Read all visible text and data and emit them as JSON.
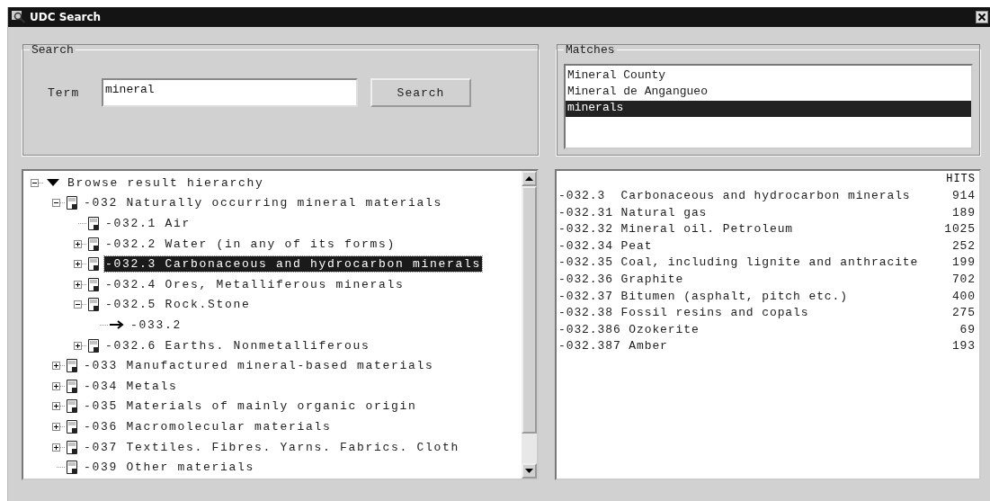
{
  "window": {
    "title": "UDC Search"
  },
  "search": {
    "legend": "Search",
    "term_label": "Term",
    "term_value": "mineral",
    "button": "Search"
  },
  "matches": {
    "legend": "Matches",
    "items": [
      {
        "label": "Mineral County",
        "selected": false
      },
      {
        "label": "Mineral de Angangueo",
        "selected": false
      },
      {
        "label": "minerals",
        "selected": true
      }
    ]
  },
  "tree": {
    "root": {
      "label": "Browse result hierarchy",
      "kind": "root",
      "expanded": true,
      "selected": false,
      "children": [
        {
          "label": "-032 Naturally occurring mineral materials",
          "kind": "doc",
          "expanded": true,
          "selected": false,
          "children": [
            {
              "label": "-032.1 Air",
              "kind": "doc",
              "selected": false
            },
            {
              "label": "-032.2 Water (in any of its forms)",
              "kind": "doc",
              "expanded": false,
              "selected": false
            },
            {
              "label": "-032.3 Carbonaceous and hydrocarbon minerals",
              "kind": "doc",
              "expanded": false,
              "selected": true
            },
            {
              "label": "-032.4 Ores, Metalliferous minerals",
              "kind": "doc",
              "expanded": false,
              "selected": false
            },
            {
              "label": "-032.5 Rock.Stone",
              "kind": "doc",
              "expanded": true,
              "selected": false,
              "children": [
                {
                  "label": "-033.2",
                  "kind": "ref",
                  "selected": false
                }
              ]
            },
            {
              "label": "-032.6 Earths. Nonmetalliferous",
              "kind": "doc",
              "expanded": false,
              "selected": false
            }
          ]
        },
        {
          "label": "-033 Manufactured mineral-based materials",
          "kind": "doc",
          "expanded": false,
          "selected": false
        },
        {
          "label": "-034 Metals",
          "kind": "doc",
          "expanded": false,
          "selected": false
        },
        {
          "label": "-035 Materials of mainly organic origin",
          "kind": "doc",
          "expanded": false,
          "selected": false
        },
        {
          "label": "-036 Macromolecular materials",
          "kind": "doc",
          "expanded": false,
          "selected": false
        },
        {
          "label": "-037 Textiles. Fibres. Yarns. Fabrics. Cloth",
          "kind": "doc",
          "expanded": false,
          "selected": false
        },
        {
          "label": "-039 Other materials",
          "kind": "doc",
          "selected": false
        }
      ]
    }
  },
  "results": {
    "hits_header": "HITS",
    "rows": [
      {
        "label": "-032.3  Carbonaceous and hydrocarbon minerals",
        "hits": "914"
      },
      {
        "label": "-032.31 Natural gas",
        "hits": "189"
      },
      {
        "label": "-032.32 Mineral oil. Petroleum",
        "hits": "1025"
      },
      {
        "label": "-032.34 Peat",
        "hits": "252"
      },
      {
        "label": "-032.35 Coal, including lignite and anthracite",
        "hits": "199"
      },
      {
        "label": "-032.36 Graphite",
        "hits": "702"
      },
      {
        "label": "-032.37 Bitumen (asphalt, pitch etc.)",
        "hits": "400"
      },
      {
        "label": "-032.38 Fossil resins and copals",
        "hits": "275"
      },
      {
        "label": "-032.386 Ozokerite",
        "hits": "69"
      },
      {
        "label": "-032.387 Amber",
        "hits": "193"
      }
    ]
  }
}
